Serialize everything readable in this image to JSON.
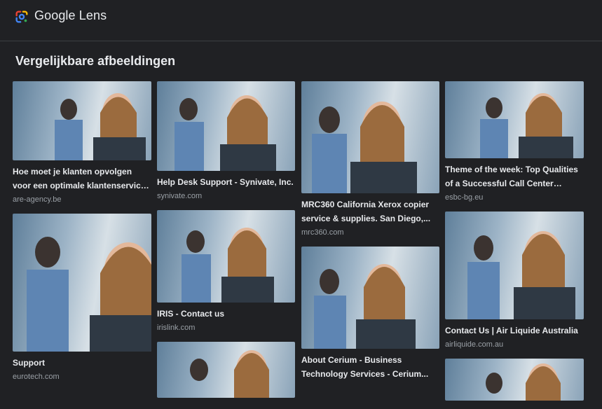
{
  "header": {
    "app_name": "Google Lens"
  },
  "section": {
    "title": "Vergelijkbare afbeeldingen"
  },
  "columns": [
    [
      {
        "title": "Hoe moet je klanten opvolgen voor een optimale klantenservice? - Ar...",
        "source": "are-agency.be"
      },
      {
        "title": "Support",
        "source": "eurotech.com"
      }
    ],
    [
      {
        "title": "Help Desk Support - Synivate, Inc.",
        "source": "synivate.com"
      },
      {
        "title": "IRIS - Contact us",
        "source": "irislink.com"
      },
      {
        "title": "",
        "source": ""
      }
    ],
    [
      {
        "title": "MRC360 California Xerox copier service & supplies. San Diego,...",
        "source": "mrc360.com"
      },
      {
        "title": "About Cerium - Business Technology Services - Cerium...",
        "source": ""
      }
    ],
    [
      {
        "title": "Theme of the week: Top Qualities of a Successful Call Center Agent...",
        "source": "esbc-bg.eu"
      },
      {
        "title": "Contact Us | Air Liquide Australia",
        "source": "airliquide.com.au"
      },
      {
        "title": "",
        "source": ""
      }
    ]
  ],
  "colors": {
    "background": "#202124",
    "text": "#e8eaed",
    "muted": "#9aa0a6",
    "divider": "#3c4043"
  },
  "icons": {
    "logo": "google-lens-logo-icon"
  }
}
